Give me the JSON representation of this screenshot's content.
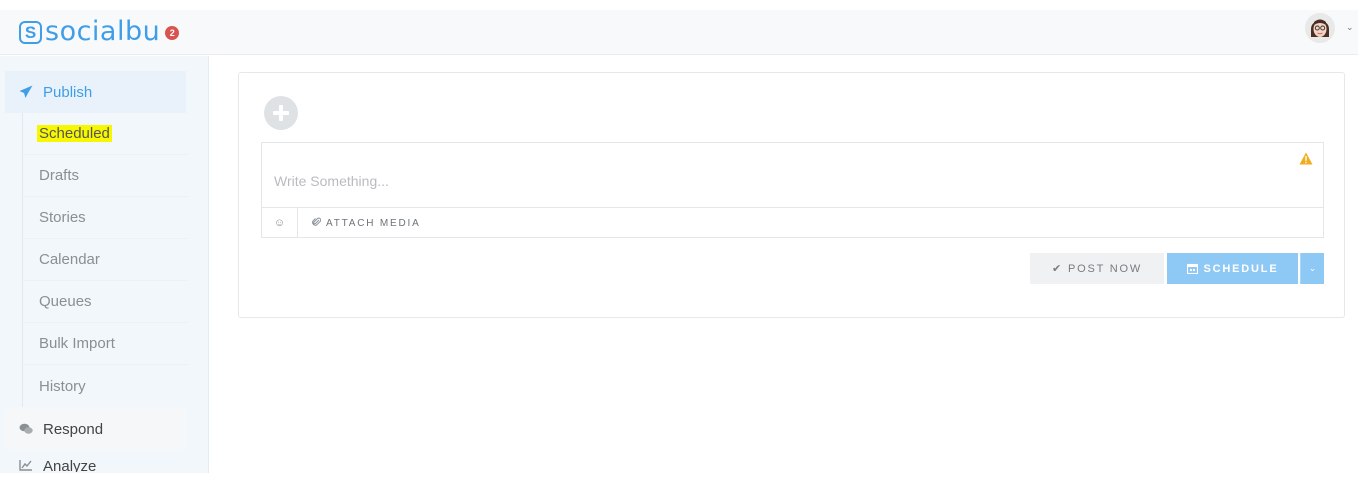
{
  "app": {
    "logo_mark": "S",
    "name": "socialbu",
    "notification_count": "2",
    "brand_color": "#3f9ee8",
    "badge_color": "#d9534f"
  },
  "user_menu": {
    "caret": "⌄"
  },
  "sidebar": {
    "publish": {
      "label": "Publish",
      "icon": "paper-plane-icon",
      "active": true
    },
    "publish_items": [
      {
        "label": "Scheduled",
        "highlighted": true
      },
      {
        "label": "Drafts"
      },
      {
        "label": "Stories"
      },
      {
        "label": "Calendar"
      },
      {
        "label": "Queues"
      },
      {
        "label": "Bulk Import"
      },
      {
        "label": "History"
      }
    ],
    "respond": {
      "label": "Respond",
      "icon": "comments-icon"
    },
    "analyze": {
      "label": "Analyze",
      "icon": "line-chart-icon"
    }
  },
  "composer": {
    "placeholder": "Write Something...",
    "emoji_glyph": "☺",
    "attach_label": "ATTACH MEDIA",
    "attach_icon": "paperclip-icon",
    "warning_icon": "warning-icon",
    "warning_color": "#f0ad1e"
  },
  "actions": {
    "post_now_label": "POST NOW",
    "post_now_glyph": "✔",
    "schedule_label": "SCHEDULE",
    "schedule_color": "#8ec8f5",
    "caret": "⌄"
  }
}
